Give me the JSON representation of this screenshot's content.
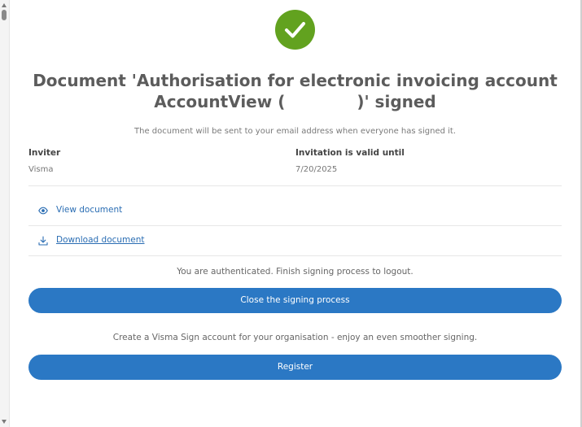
{
  "page": {
    "title": "Document 'Authorisation for electronic invoicing account AccountView (",
    "title_end": ")' signed",
    "subtitle": "The document will be sent to your email address when everyone has signed it."
  },
  "details": {
    "inviter_label": "Inviter",
    "inviter_value": "Visma",
    "valid_label": "Invitation is valid until",
    "valid_value": "7/20/2025"
  },
  "links": {
    "view": "View document",
    "download": "Download document"
  },
  "auth_text": "You are authenticated. Finish signing process to logout.",
  "close_button": "Close the signing process",
  "register_text": "Create a Visma Sign account for your organisation - enjoy an even smoother signing.",
  "register_button": "Register",
  "colors": {
    "accent": "#2b78c4",
    "success": "#62a21f",
    "link": "#2a6db3"
  },
  "icons": [
    "checkmark-icon",
    "eye-icon",
    "download-icon"
  ]
}
